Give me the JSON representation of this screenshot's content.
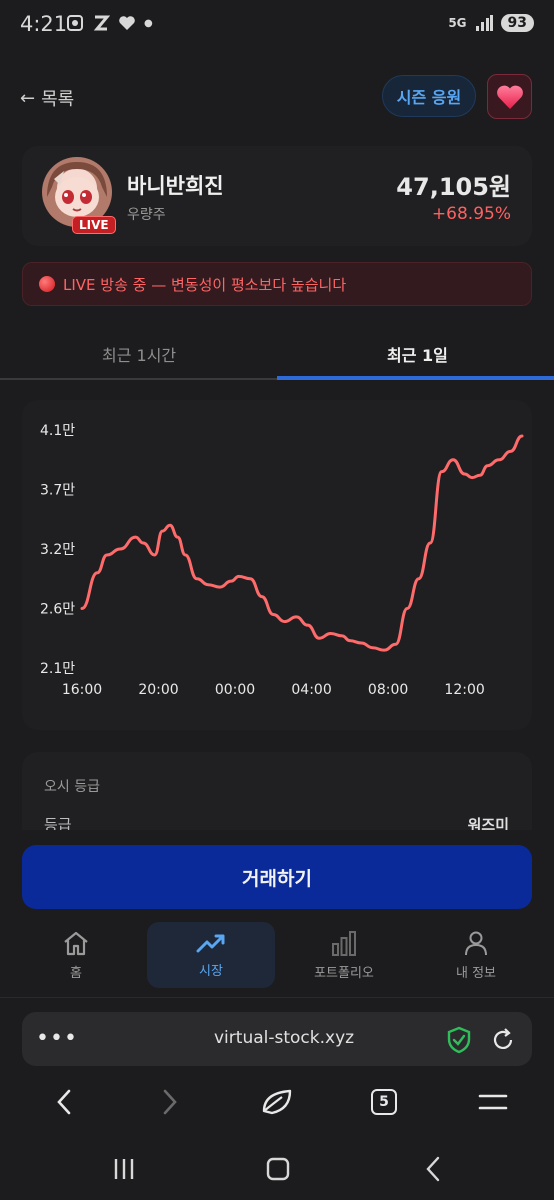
{
  "status_bar": {
    "time": "4:21",
    "network": "5G",
    "battery": "93"
  },
  "header": {
    "back_label": "목록",
    "season_button": "시즌 응원"
  },
  "stock": {
    "name": "바니반희진",
    "category": "우량주",
    "live_badge": "LIVE",
    "price": "47,105원",
    "change": "+68.95%"
  },
  "live_banner": {
    "text": "LIVE 방송 중 — 변동성이 평소보다 높습니다"
  },
  "tabs": [
    {
      "label": "최근 1시간",
      "active": false
    },
    {
      "label": "최근 1일",
      "active": true
    }
  ],
  "chart_data": {
    "type": "line",
    "title": "",
    "xlabel": "",
    "ylabel": "",
    "y_ticks": [
      "4.1만",
      "3.7만",
      "3.2만",
      "2.6만",
      "2.1만"
    ],
    "x_ticks": [
      "16:00",
      "20:00",
      "00:00",
      "04:00",
      "08:00",
      "12:00"
    ],
    "x_tick_positions": [
      0,
      4,
      8,
      12,
      16,
      20
    ],
    "ylim": [
      21000,
      41000
    ],
    "xlim": [
      0,
      23
    ],
    "line_color": "#ff6b6b",
    "series": [
      {
        "name": "",
        "x": [
          0,
          0.8,
          1.3,
          2.0,
          2.8,
          3.2,
          3.8,
          4.2,
          4.6,
          5.0,
          5.4,
          6.0,
          6.6,
          7.2,
          7.8,
          8.2,
          8.8,
          9.4,
          10.0,
          10.6,
          11.2,
          11.8,
          12.4,
          13.0,
          13.6,
          14.0,
          14.6,
          15.2,
          15.8,
          16.4,
          17.0,
          17.6,
          18.2,
          18.8,
          19.4,
          20.0,
          20.4,
          20.8,
          21.2,
          21.8,
          22.4,
          23.0
        ],
        "y": [
          26000,
          29000,
          30500,
          31000,
          32000,
          31500,
          30500,
          32500,
          33000,
          32000,
          30500,
          28500,
          28000,
          27800,
          28300,
          28700,
          28500,
          27000,
          25500,
          24900,
          25300,
          24600,
          23500,
          23900,
          23700,
          23300,
          23100,
          22700,
          22500,
          23000,
          26000,
          28500,
          31500,
          37500,
          38500,
          37300,
          37000,
          37200,
          38000,
          38500,
          39200,
          40500
        ]
      }
    ],
    "grid": false
  },
  "grade_card": {
    "title": "오시 등급",
    "key": "등급",
    "value": "워즈미"
  },
  "trade_button": "거래하기",
  "bottom_nav": [
    {
      "label": "홈",
      "icon": "home-icon"
    },
    {
      "label": "시장",
      "icon": "trending-up-icon",
      "active": true
    },
    {
      "label": "포트폴리오",
      "icon": "bar-chart-icon"
    },
    {
      "label": "내 정보",
      "icon": "user-icon"
    }
  ],
  "browser": {
    "url": "virtual-stock.xyz",
    "tab_count": "5"
  }
}
